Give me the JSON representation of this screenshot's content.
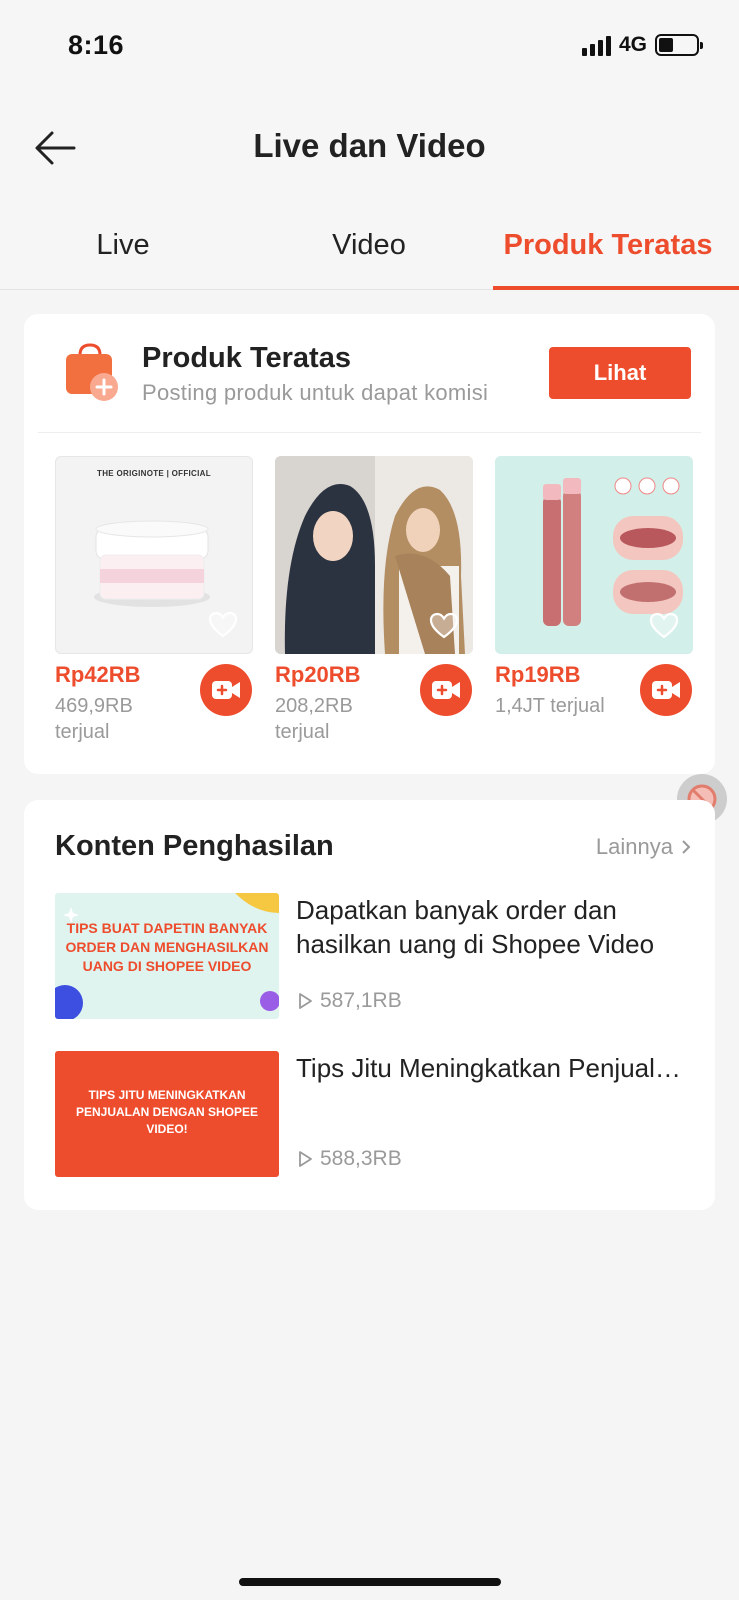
{
  "status": {
    "time": "8:16",
    "network": "4G",
    "battery_level": 0.35
  },
  "header": {
    "title": "Live dan Video",
    "back_icon": "arrow-left-icon"
  },
  "tabs": [
    {
      "label": "Live",
      "active": false
    },
    {
      "label": "Video",
      "active": false
    },
    {
      "label": "Produk Teratas",
      "active": true
    }
  ],
  "top_products": {
    "title": "Produk Teratas",
    "subtitle": "Posting produk untuk dapat komisi",
    "button_label": "Lihat",
    "brand_label": "THE ORIGINOTE | OFFICIAL",
    "items": [
      {
        "price": "Rp42RB",
        "sold": "469,9RB terjual",
        "image": "moisturizer-jar"
      },
      {
        "price": "Rp20RB",
        "sold": "208,2RB terjual",
        "image": "hijab-models"
      },
      {
        "price": "Rp19RB",
        "sold": "1,4JT terjual",
        "image": "lip-tint"
      }
    ]
  },
  "earning_content": {
    "title": "Konten Penghasilan",
    "more_label": "Lainnya",
    "videos": [
      {
        "title": "Dapatkan banyak order dan hasilkan uang di Shopee Video",
        "views": "587,1RB",
        "thumb_text": "TIPS BUAT DAPETIN BANYAK ORDER DAN MENGHASILKAN UANG DI SHOPEE VIDEO"
      },
      {
        "title": "Tips Jitu Meningkatkan Penjualan Dengan Shopee Vi...",
        "views": "588,3RB",
        "thumb_text": "TIPS JITU MENINGKATKAN PENJUALAN DENGAN SHOPEE VIDEO!"
      }
    ]
  },
  "colors": {
    "accent": "#ee4d2d",
    "muted": "#9a9a9a",
    "background": "#f5f5f5"
  }
}
